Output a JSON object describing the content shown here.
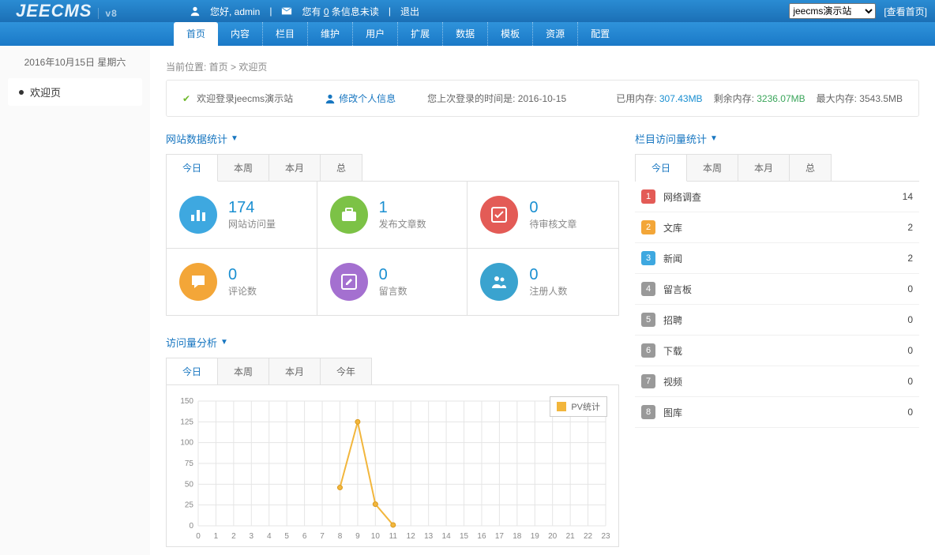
{
  "brand": {
    "name": "JEECMS",
    "version": "v8"
  },
  "topbar": {
    "greeting_prefix": "您好, ",
    "user": "admin",
    "mail_prefix": "您有 ",
    "unread_count": "0",
    "mail_suffix": " 条信息未读",
    "logout": "退出",
    "site_selected": "jeecms演示站",
    "view_home": "[查看首页]"
  },
  "nav": [
    "首页",
    "内容",
    "栏目",
    "维护",
    "用户",
    "扩展",
    "数据",
    "模板",
    "资源",
    "配置"
  ],
  "side": {
    "date": "2016年10月15日 星期六",
    "welcome": "欢迎页"
  },
  "breadcrumb": {
    "label": "当前位置: ",
    "home": "首页",
    "page": "欢迎页"
  },
  "infobar": {
    "welcome": "欢迎登录jeecms演示站",
    "edit_profile": "修改个人信息",
    "last_login_prefix": "您上次登录的时间是: ",
    "last_login": "2016-10-15",
    "mem_used_label": "已用内存: ",
    "mem_used": "307.43MB",
    "mem_free_label": "剩余内存: ",
    "mem_free": "3236.07MB",
    "mem_max_label": "最大内存: ",
    "mem_max": "3543.5MB"
  },
  "periods": {
    "today": "今日",
    "week": "本周",
    "month": "本月",
    "total": "总",
    "year": "今年"
  },
  "sections": {
    "site_stats": "网站数据统计",
    "column_stats": "栏目访问量统计",
    "traffic": "访问量分析"
  },
  "stats": [
    {
      "value": "174",
      "label": "网站访问量",
      "icon": "bar-chart-icon",
      "color": "c-blue"
    },
    {
      "value": "1",
      "label": "发布文章数",
      "icon": "briefcase-icon",
      "color": "c-green"
    },
    {
      "value": "0",
      "label": "待审核文章",
      "icon": "check-icon",
      "color": "c-red"
    },
    {
      "value": "0",
      "label": "评论数",
      "icon": "comment-icon",
      "color": "c-orange"
    },
    {
      "value": "0",
      "label": "留言数",
      "icon": "edit-icon",
      "color": "c-purple"
    },
    {
      "value": "0",
      "label": "注册人数",
      "icon": "users-icon",
      "color": "c-teal"
    }
  ],
  "rank": [
    {
      "name": "网络调查",
      "count": "14"
    },
    {
      "name": "文库",
      "count": "2"
    },
    {
      "name": "新闻",
      "count": "2"
    },
    {
      "name": "留言板",
      "count": "0"
    },
    {
      "name": "招聘",
      "count": "0"
    },
    {
      "name": "下载",
      "count": "0"
    },
    {
      "name": "视频",
      "count": "0"
    },
    {
      "name": "图库",
      "count": "0"
    }
  ],
  "chart_legend": "PV统计",
  "chart_data": {
    "type": "line",
    "title": "访问量分析 今日",
    "xlabel": "",
    "ylabel": "",
    "ylim": [
      0,
      150
    ],
    "categories": [
      0,
      1,
      2,
      3,
      4,
      5,
      6,
      7,
      8,
      9,
      10,
      11,
      12,
      13,
      14,
      15,
      16,
      17,
      18,
      19,
      20,
      21,
      22,
      23
    ],
    "series": [
      {
        "name": "PV统计",
        "values": [
          null,
          null,
          null,
          null,
          null,
          null,
          null,
          null,
          46,
          125,
          26,
          1,
          null,
          null,
          null,
          null,
          null,
          null,
          null,
          null,
          null,
          null,
          null,
          null
        ]
      }
    ]
  }
}
